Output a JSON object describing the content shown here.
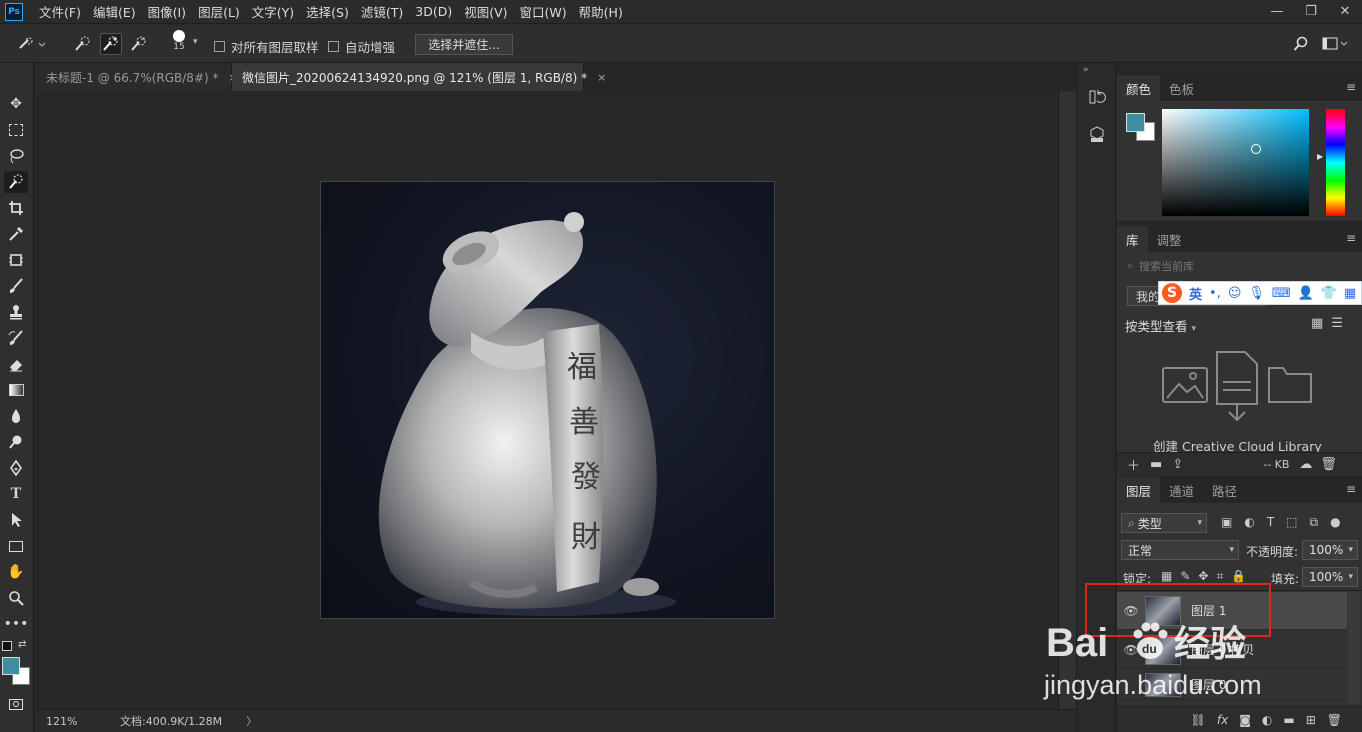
{
  "app": {
    "logo": "Ps"
  },
  "menu": [
    "文件(F)",
    "编辑(E)",
    "图像(I)",
    "图层(L)",
    "文字(Y)",
    "选择(S)",
    "滤镜(T)",
    "3D(D)",
    "视图(V)",
    "窗口(W)",
    "帮助(H)"
  ],
  "window_controls": {
    "minimize": "—",
    "restore": "❐",
    "close": "✕"
  },
  "options": {
    "brush_size": "15",
    "sample_all_layers": "对所有图层取样",
    "auto_enhance": "自动增强",
    "select_and_mask": "选择并遮住..."
  },
  "tabs": [
    {
      "title": "未标题-1 @ 66.7%(RGB/8#) *",
      "close": "×"
    },
    {
      "title": "微信图片_20200624134920.png @ 121% (图层 1, RGB/8) *",
      "close": "×"
    }
  ],
  "status": {
    "zoom": "121%",
    "doc": "文档:400.9K/1.28M",
    "arrow": "〉"
  },
  "color_panel": {
    "tabs": [
      "颜色",
      "色板"
    ],
    "foreground": "#3e8ea1",
    "background": "#ffffff"
  },
  "library_panel": {
    "tabs": [
      "库",
      "调整"
    ],
    "search_placeholder": "搜索当前库",
    "library_name": "我的",
    "view_by": "按类型查看",
    "create_text": "创建 Creative Cloud Library",
    "size": "-- KB"
  },
  "ime": {
    "logo": "S",
    "mode": "英"
  },
  "layers_panel": {
    "tabs": [
      "图层",
      "通道",
      "路径"
    ],
    "filter": "类型",
    "blend_mode": "正常",
    "opacity_label": "不透明度:",
    "opacity": "100%",
    "lock_label": "锁定:",
    "fill_label": "填充:",
    "fill": "100%",
    "layers": [
      {
        "name": "图层 1",
        "selected": true
      },
      {
        "name": "图层 0 拷贝",
        "selected": false
      },
      {
        "name": "图层 0",
        "selected": false
      }
    ]
  },
  "watermark": {
    "brand": "Bai",
    "paw": "du",
    "product": "经验",
    "url": "jingyan.baidu.com"
  },
  "seal_text": [
    "福",
    "善",
    "發",
    "財"
  ]
}
